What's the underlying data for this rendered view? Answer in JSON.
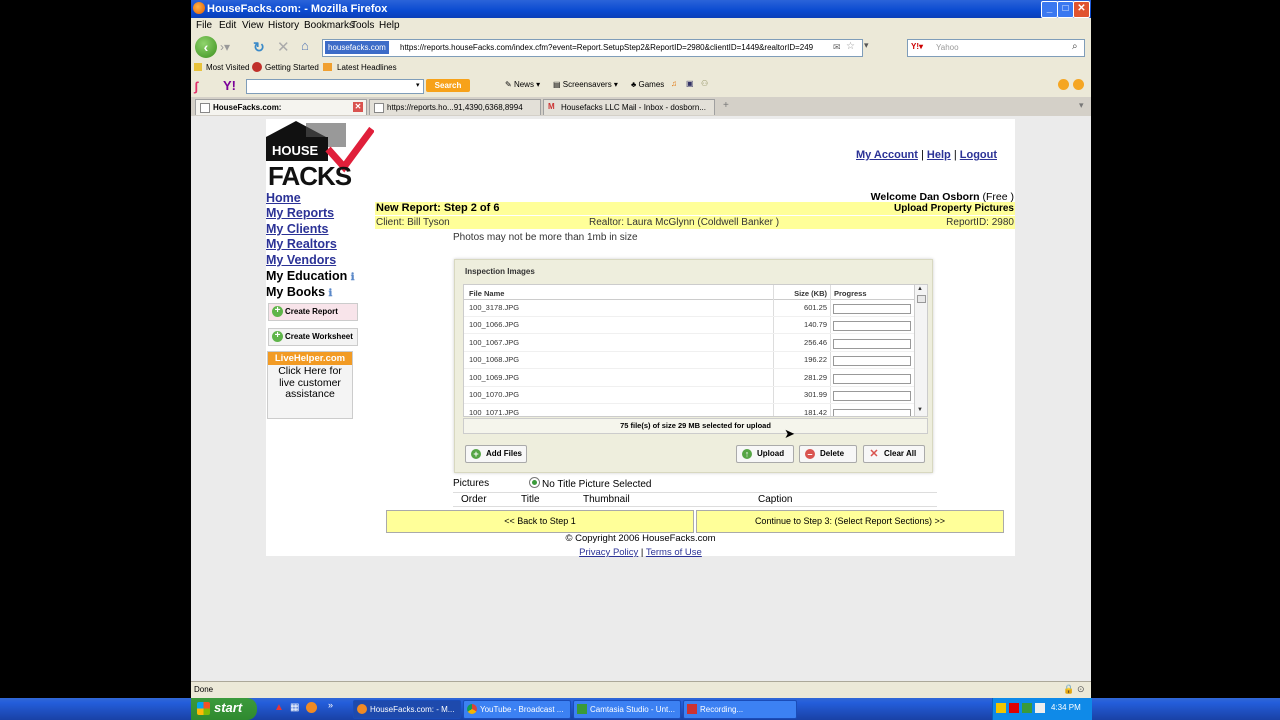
{
  "window": {
    "title": "HouseFacks.com: - Mozilla Firefox"
  },
  "menu": [
    "File",
    "Edit",
    "View",
    "History",
    "Bookmarks",
    "Tools",
    "Help"
  ],
  "nav": {
    "domain": "housefacks.com",
    "url": "https://reports.houseFacks.com/index.cfm?event=Report.SetupStep2&ReportID=2980&clientID=1449&realtorID=249",
    "search_placeholder": "Yahoo"
  },
  "bookmarks": [
    "Most Visited",
    "Getting Started",
    "Latest Headlines"
  ],
  "yahoo_toolbar": {
    "search_label": "Search",
    "items": [
      "News",
      "Screensavers",
      "Games"
    ]
  },
  "tabs": [
    {
      "label": "HouseFacks.com:"
    },
    {
      "label": "https://reports.ho...91,4390,6368,8994"
    },
    {
      "label": "Housefacks LLC Mail - Inbox - dosborn..."
    }
  ],
  "header": {
    "links": [
      "My Account",
      "Help",
      "Logout"
    ],
    "separator": "|",
    "welcome": "Welcome Dan Osborn",
    "welcome_plan": "(Free )"
  },
  "logo": {
    "line1": "HOUSE",
    "line2": "FACKS"
  },
  "sidebar": {
    "links": [
      "Home",
      "My Reports",
      "My Clients",
      "My Realtors",
      "My Vendors"
    ],
    "plain": [
      "My Education",
      "My Books"
    ],
    "buttons": [
      "Create Report",
      "Create Worksheet"
    ],
    "livehelper": {
      "brand": "LiveHelper.com",
      "text": "Click Here for live customer assistance"
    }
  },
  "report": {
    "step": "New Report: Step 2 of 6",
    "section": "Upload Property Pictures",
    "client": "Client: Bill Tyson",
    "realtor": "Realtor: Laura McGlynn (Coldwell Banker )",
    "report_id": "ReportID: 2980",
    "note": "Photos may not be more than 1mb in size"
  },
  "uploader": {
    "title": "Inspection Images",
    "columns": [
      "File Name",
      "Size (KB)",
      "Progress"
    ],
    "files": [
      {
        "name": "100_3178.JPG",
        "size": "601.25"
      },
      {
        "name": "100_1066.JPG",
        "size": "140.79"
      },
      {
        "name": "100_1067.JPG",
        "size": "256.46"
      },
      {
        "name": "100_1068.JPG",
        "size": "196.22"
      },
      {
        "name": "100_1069.JPG",
        "size": "281.29"
      },
      {
        "name": "100_1070.JPG",
        "size": "301.99"
      },
      {
        "name": "100_1071.JPG",
        "size": "181.42"
      }
    ],
    "status": "75 file(s) of size 29 MB selected for upload",
    "buttons": {
      "add": "Add Files",
      "upload": "Upload",
      "delete": "Delete",
      "clear": "Clear All"
    }
  },
  "pictures": {
    "label": "Pictures",
    "title_pic": "No Title Picture Selected",
    "columns": [
      "Order",
      "Title",
      "Thumbnail",
      "Caption"
    ]
  },
  "footer_nav": {
    "back": "<< Back to Step 1",
    "continue": "Continue to Step 3: (Select Report Sections) >>"
  },
  "footer": {
    "copyright": "© Copyright 2006 HouseFacks.com",
    "privacy": "Privacy Policy",
    "terms": "Terms of Use",
    "sep": "|"
  },
  "statusbar": {
    "text": "Done"
  },
  "taskbar": {
    "start": "start",
    "tasks": [
      "HouseFacks.com: - M...",
      "YouTube - Broadcast ...",
      "Camtasia Studio - Unt...",
      "Recording..."
    ],
    "clock": "4:34 PM"
  }
}
